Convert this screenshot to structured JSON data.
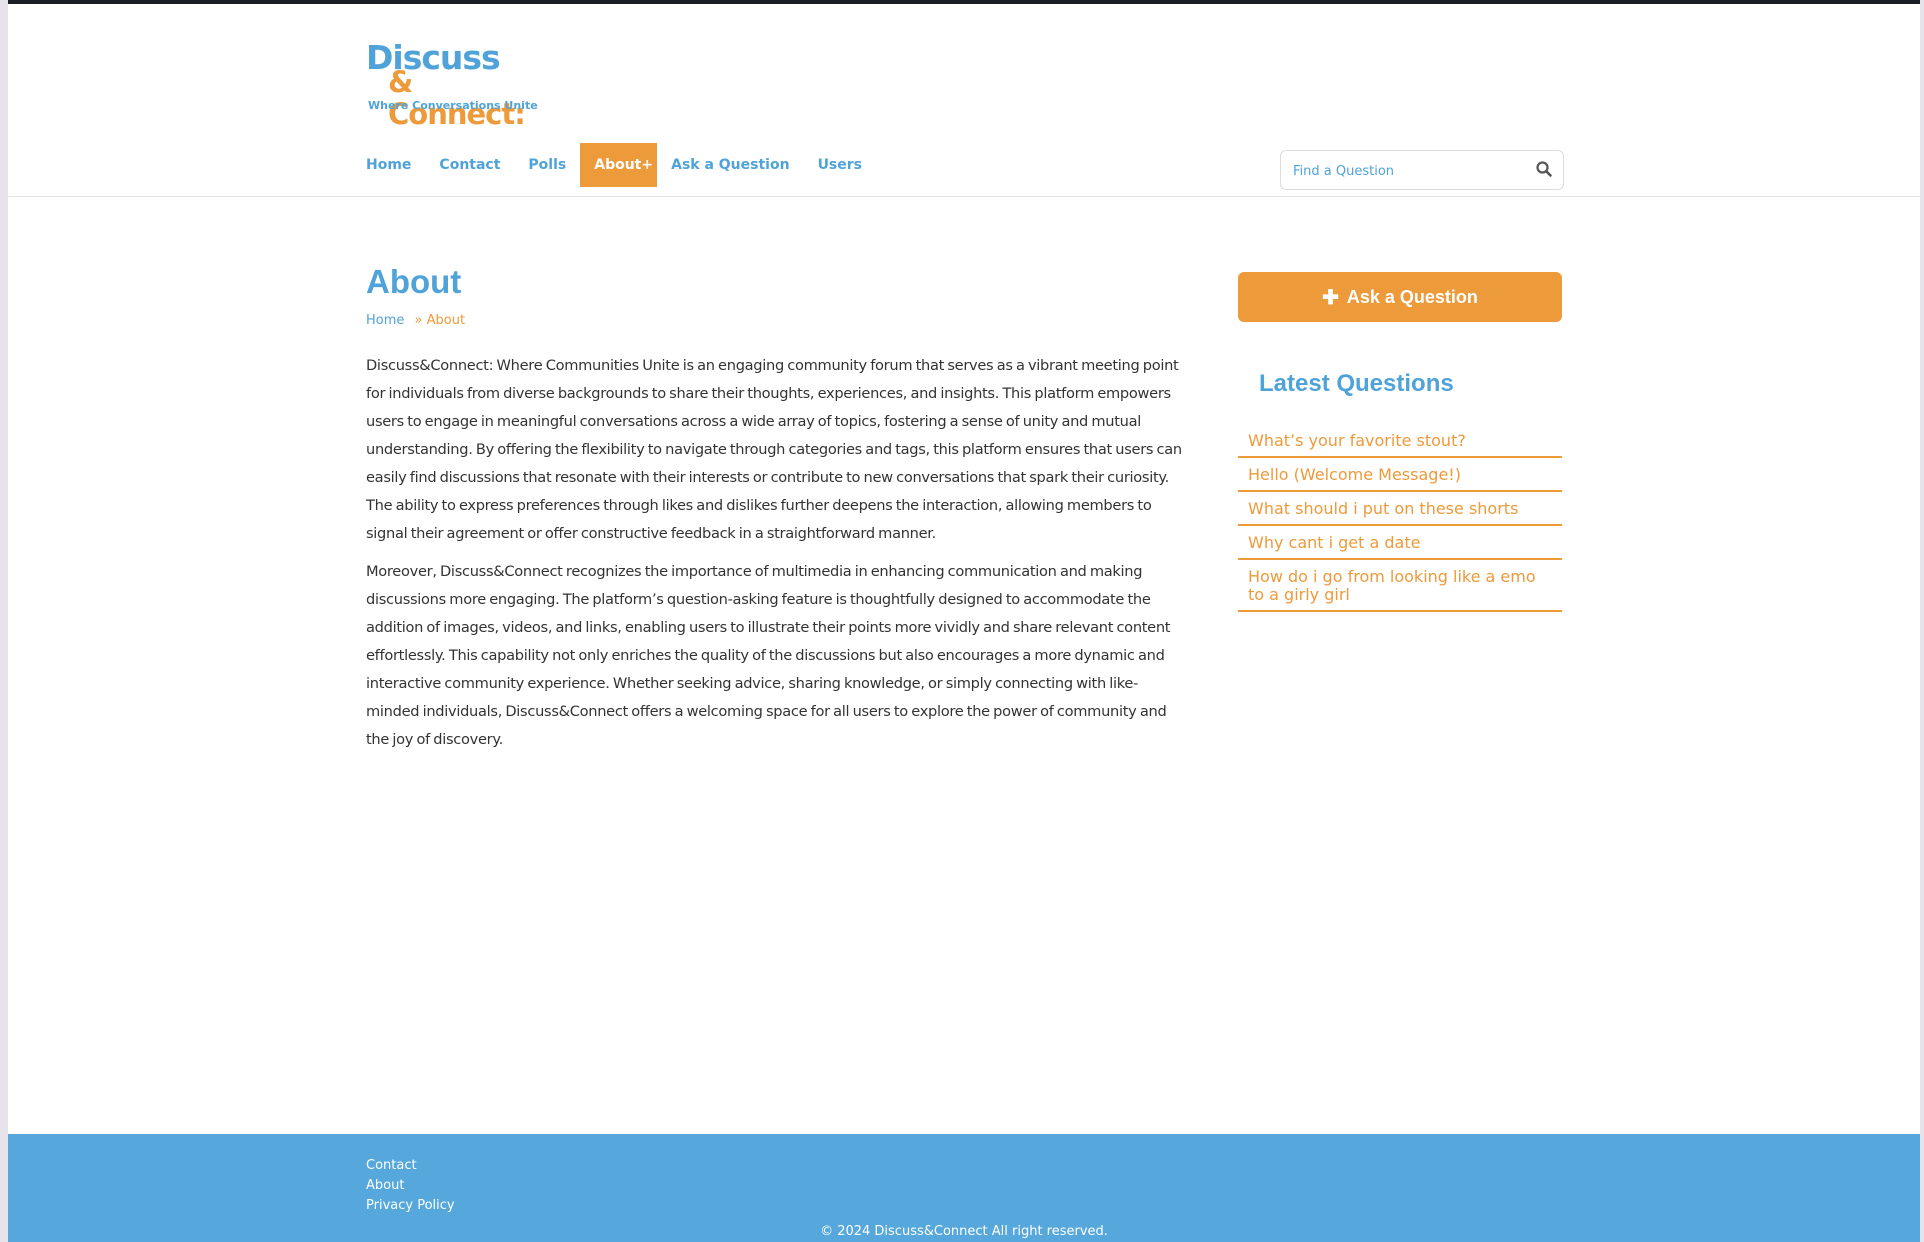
{
  "logo": {
    "line1": "Discuss",
    "line2": "& Connect:",
    "tagline": "Where Conversations Unite"
  },
  "nav": {
    "items": [
      "Home",
      "Contact",
      "Polls",
      "About+",
      "Ask a Question",
      "Users"
    ],
    "active": "About+"
  },
  "search": {
    "placeholder": "Find a Question",
    "icon": "search-icon"
  },
  "page": {
    "title": "About",
    "breadcrumb": {
      "home": "Home",
      "separator": "»",
      "current": "About"
    },
    "paragraphs": [
      "Discuss&Connect: Where Communities Unite is an engaging community forum that serves as a vibrant meeting point for individuals from diverse backgrounds to share their thoughts, experiences, and insights. This platform empowers users to engage in meaningful conversations across a wide array of topics, fostering a sense of unity and mutual understanding. By offering the flexibility to navigate through categories and tags, this platform ensures that users can easily find discussions that resonate with their interests or contribute to new conversations that spark their curiosity. The ability to express preferences through likes and dislikes further deepens the interaction, allowing members to signal their agreement or offer constructive feedback in a straightforward manner.",
      "Moreover, Discuss&Connect recognizes the importance of multimedia in enhancing communication and making discussions more engaging. The platform’s question-asking feature is thoughtfully designed to accommodate the addition of images, videos, and links, enabling users to illustrate their points more vividly and share relevant content effortlessly. This capability not only enriches the quality of the discussions but also encourages a more dynamic and interactive community experience. Whether seeking advice, sharing knowledge, or simply connecting with like-minded individuals, Discuss&Connect offers a welcoming space for all users to explore the power of community and the joy of discovery."
    ]
  },
  "sidebar": {
    "ask_button": "Ask a Question",
    "ask_icon": "plus-icon",
    "latest_title": "Latest Questions",
    "questions": [
      "What’s your favorite stout?",
      "Hello (Welcome Message!)",
      "What should i put on these shorts",
      "Why cant i get a date",
      "How do i go from looking like a emo to a girly girl"
    ]
  },
  "footer": {
    "links": [
      "Contact",
      "About",
      "Privacy Policy"
    ],
    "copyright": "© 2024 Discuss&Connect All right reserved."
  },
  "colors": {
    "brand_blue": "#4fa3d8",
    "brand_orange": "#ed9a3b",
    "footer_blue": "#56a8dc",
    "text": "#333333"
  }
}
